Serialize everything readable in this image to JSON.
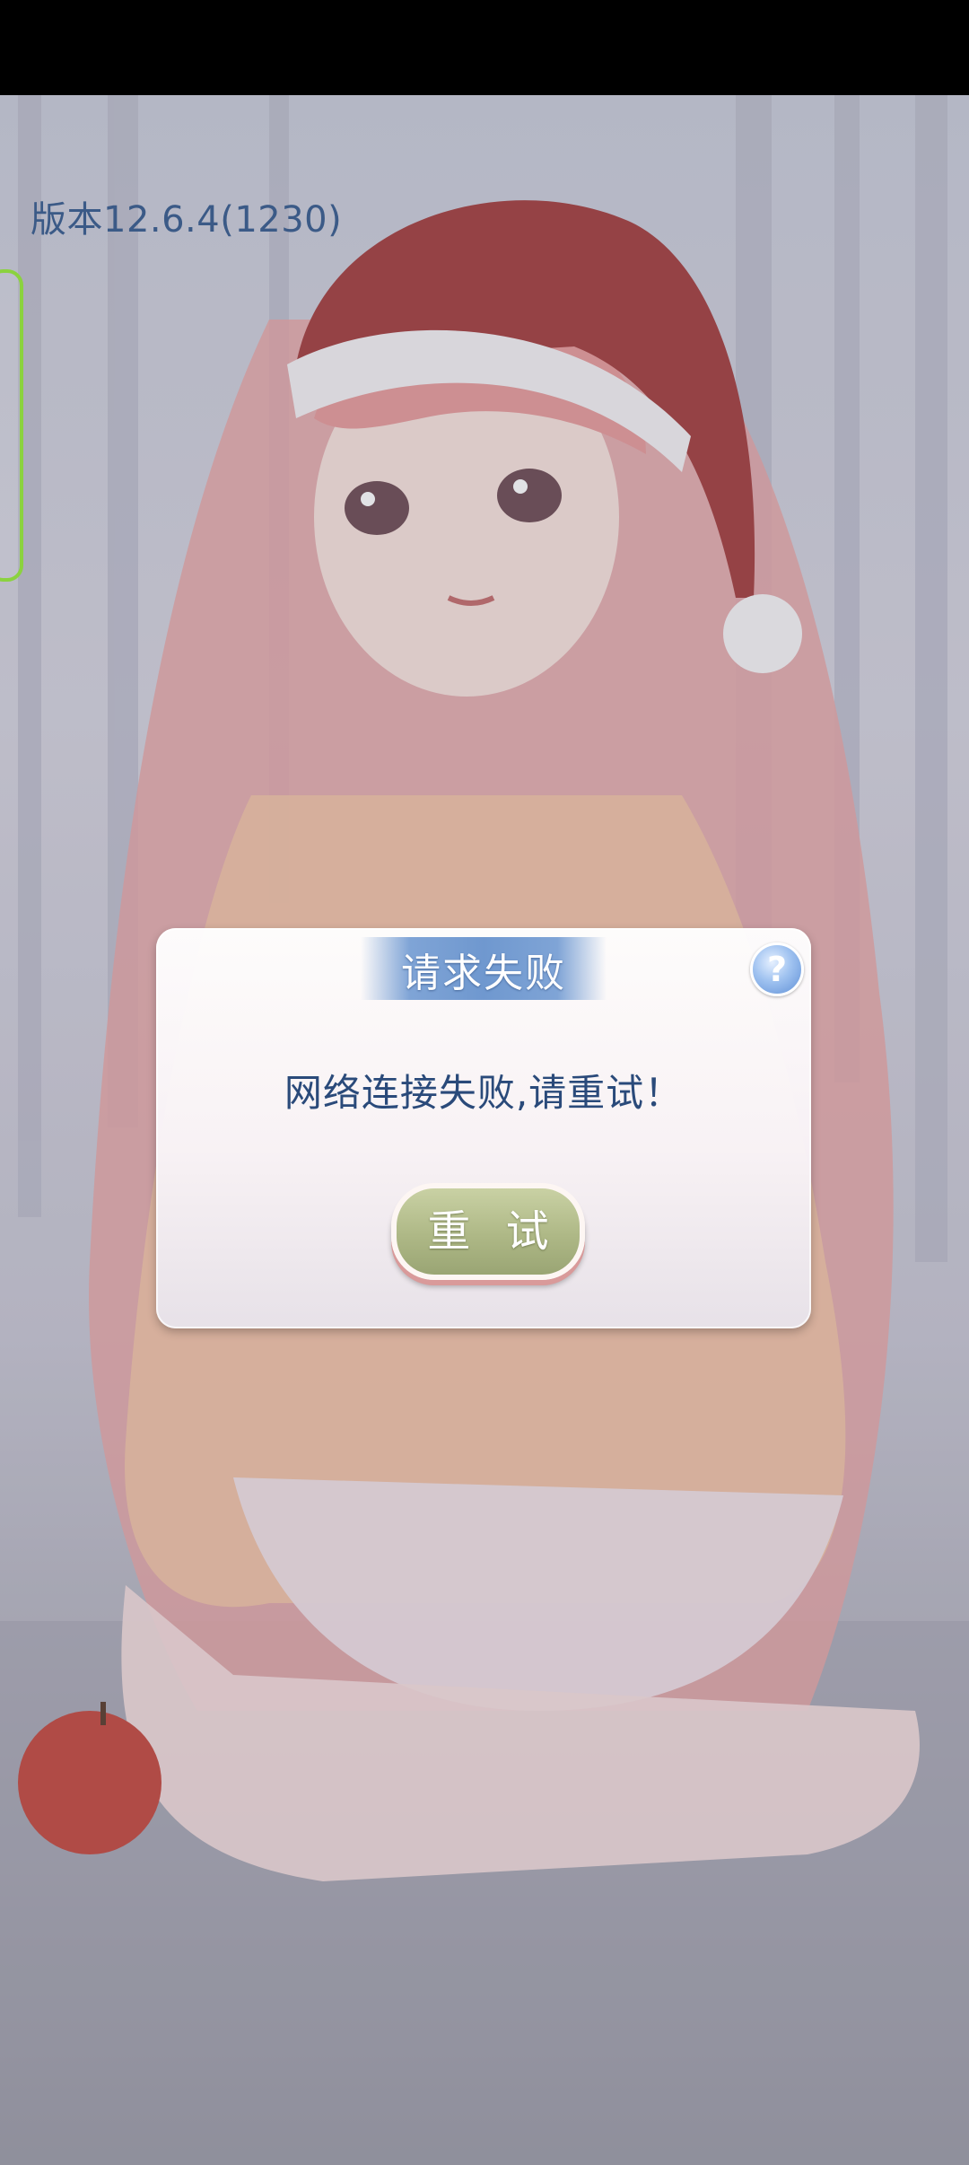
{
  "app": {
    "version_text": "版本12.6.4(1230)"
  },
  "dialog": {
    "title": "请求失败",
    "help_icon_glyph": "?",
    "message": "网络连接失败,请重试！",
    "retry_label": "重 试"
  },
  "icons": {
    "help": "help-icon"
  },
  "colors": {
    "version_text": "#3b5a87",
    "title_banner": "#6f98cf",
    "message_text": "#2a4a7a",
    "retry_button": "#aeb886",
    "side_handle": "#8bd23f"
  }
}
